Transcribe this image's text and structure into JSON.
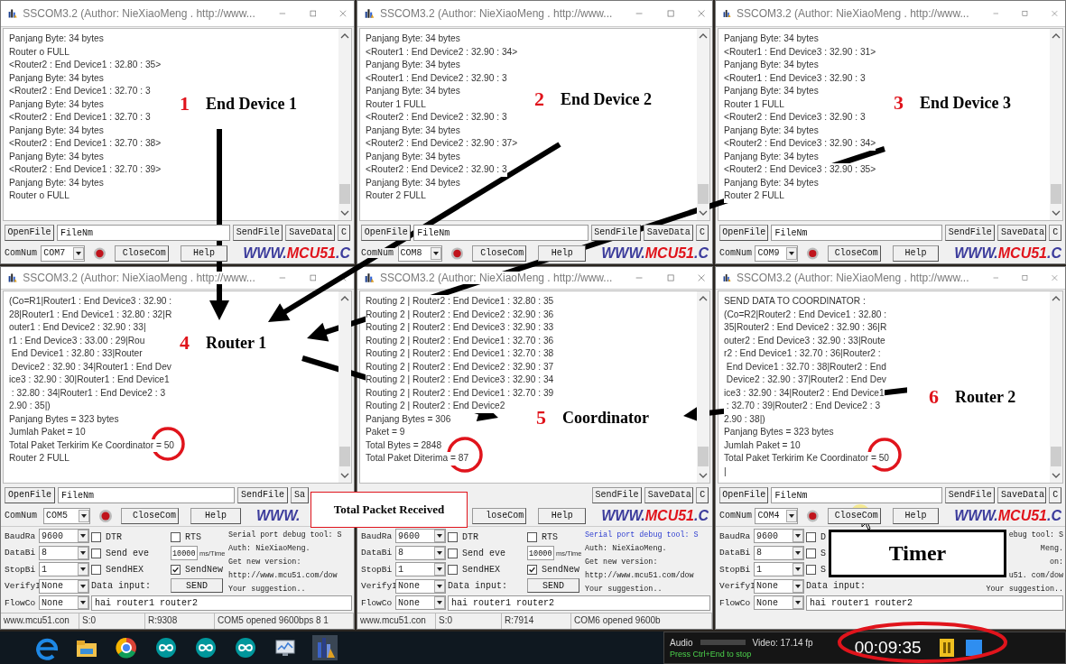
{
  "windows": [
    {
      "title": "SSCOM3.2 (Author: NieXiaoMeng . http://www...",
      "log": [
        "Panjang Byte: 34 bytes",
        "Router o FULL",
        "<Router2 : End Device1 : 32.80 : 35>",
        "Panjang Byte: 34 bytes",
        "<Router2 : End Device1 : 32.70 : 3",
        "Panjang Byte: 34 bytes",
        "<Router2 : End Device1 : 32.70 : 3",
        "Panjang Byte: 34 bytes",
        "<Router2 : End Device1 : 32.70 : 38>",
        "Panjang Byte: 34 bytes",
        "<Router2 : End Device1 : 32.70 : 39>",
        "Panjang Byte: 34 bytes",
        "Router o FULL"
      ],
      "file_row": {
        "open_button": "OpenFile",
        "file_field": "FileNm",
        "send_file": "SendFile",
        "save_data": "SaveData",
        "cut_button": "C"
      },
      "com_row": {
        "com_label": "ComNum",
        "com_port": "COM7",
        "close_button": "CloseCom",
        "help_button": "Help",
        "logo": {
          "prefix": "WWW.",
          "brand": "MCU51",
          "suffix": ".C"
        }
      }
    },
    {
      "title": "SSCOM3.2 (Author: NieXiaoMeng . http://www...",
      "log": [
        "Panjang Byte: 34 bytes",
        "<Router1 : End Device2 : 32.90 : 34>",
        "Panjang Byte: 34 bytes",
        "<Router1 : End Device2 : 32.90 : 3",
        "Panjang Byte: 34 bytes",
        "Router 1 FULL",
        "<Router2 : End Device2 : 32.90 : 3",
        "Panjang Byte: 34 bytes",
        "<Router2 : End Device2 : 32.90 : 37>",
        "Panjang Byte: 34 bytes",
        "<Router2 : End Device2 : 32.90 : 3",
        "Panjang Byte: 34 bytes",
        "Router 2 FULL"
      ],
      "file_row": {
        "open_button": "OpenFile",
        "file_field": "FileNm",
        "send_file": "SendFile",
        "save_data": "SaveData",
        "cut_button": "C"
      },
      "com_row": {
        "com_label": "ComNum",
        "com_port": "COM8",
        "close_button": "CloseCom",
        "help_button": "Help",
        "logo": {
          "prefix": "WWW.",
          "brand": "MCU51",
          "suffix": ".C"
        }
      }
    },
    {
      "title": "SSCOM3.2 (Author: NieXiaoMeng . http://www...",
      "log": [
        "Panjang Byte: 34 bytes",
        "<Router1 : End Device3 : 32.90 : 31>",
        "Panjang Byte: 34 bytes",
        "<Router1 : End Device3 : 32.90 : 3",
        "Panjang Byte: 34 bytes",
        "Router 1 FULL",
        "<Router2 : End Device3 : 32.90 : 3",
        "Panjang Byte: 34 bytes",
        "<Router2 : End Device3 : 32.90 : 34>",
        "Panjang Byte: 34 bytes",
        "<Router2 : End Device3 : 32.90 : 35>",
        "Panjang Byte: 34 bytes",
        "Router 2 FULL"
      ],
      "file_row": {
        "open_button": "OpenFile",
        "file_field": "FileNm",
        "send_file": "SendFile",
        "save_data": "SaveData",
        "cut_button": "C"
      },
      "com_row": {
        "com_label": "ComNum",
        "com_port": "COM9",
        "close_button": "CloseCom",
        "help_button": "Help",
        "logo": {
          "prefix": "WWW.",
          "brand": "MCU51",
          "suffix": ".C"
        }
      }
    },
    {
      "title": "SSCOM3.2 (Author: NieXiaoMeng . http://www...",
      "log": [
        "(Co=R1|Router1 : End Device3 : 32.90 :",
        "28|Router1 : End Device1 : 32.80 : 32|R",
        "outer1 : End Device2 : 32.90 : 33|",
        "r1 : End Device3 : 33.00 : 29|Rou",
        " End Device1 : 32.80 : 33|Router",
        " Device2 : 32.90 : 34|Router1 : End Dev",
        "ice3 : 32.90 : 30|Router1 : End Device1",
        " : 32.80 : 34|Router1 : End Device2 : 3",
        "2.90 : 35|)",
        "Panjang Bytes = 323 bytes",
        "Jumlah Paket = 10",
        "Total Paket Terkirim Ke Coordinator = 50",
        "Router 2 FULL"
      ],
      "file_row": {
        "open_button": "OpenFile",
        "file_field": "FileNm",
        "send_file": "SendFile",
        "save_data": "Sa"
      },
      "com_row": {
        "com_label": "ComNum",
        "com_port": "COM5",
        "close_button": "CloseCom",
        "help_button": "Help",
        "logo": {
          "prefix": "WWW."
        }
      },
      "panel": {
        "settings": [
          {
            "label": "BaudRa",
            "value": "9600"
          },
          {
            "label": "DataBi",
            "value": "8"
          },
          {
            "label": "StopBi",
            "value": "1"
          },
          {
            "label": "VerifyI",
            "value": "None"
          },
          {
            "label": "FlowCo",
            "value": "None"
          }
        ],
        "checkboxes": [
          {
            "label": "DTR",
            "checked": false
          },
          {
            "label": "Send eve",
            "checked": false
          },
          {
            "label": "SendHEX",
            "checked": false
          }
        ],
        "checkboxes_2": [
          {
            "label": "RTS",
            "checked": false
          },
          {
            "label": "SendNew",
            "checked": true
          }
        ],
        "interval": "10000",
        "interval_unit": "ms/Time",
        "data_input_label": "Data input:",
        "send_button": "SEND",
        "info": [
          {
            "text": "Serial port debug tool: S",
            "highlighted": false
          },
          {
            "text": "Auth: NieXiaoMeng.",
            "highlighted": false
          },
          {
            "text": "Get new version:",
            "highlighted": false
          },
          {
            "text": "http://www.mcu51.com/dow",
            "highlighted": false
          },
          {
            "text": "Your suggestion..",
            "highlighted": false
          }
        ],
        "data_input": "hai router1 router2"
      },
      "status_bar": [
        "www.mcu51.con",
        "S:0",
        "R:9308",
        "COM5 opened 9600bps 8 1"
      ]
    },
    {
      "title": "SSCOM3.2 (Author: NieXiaoMeng . http://www...",
      "log": [
        "Routing 2 | Router2 : End Device1 : 32.80 : 35",
        "Routing 2 | Router2 : End Device2 : 32.90 : 36",
        "Routing 2 | Router2 : End Device3 : 32.90 : 33",
        "Routing 2 | Router2 : End Device1 : 32.70 : 36",
        "Routing 2 | Router2 : End Device1 : 32.70 : 38",
        "Routing 2 | Router2 : End Device2 : 32.90 : 37",
        "Routing 2 | Router2 : End Device3 : 32.90 : 34",
        "Routing 2 | Router2 : End Device1 : 32.70 : 39",
        "Routing 2 | Router2 : End Device2",
        "Panjang Bytes = 306",
        "Paket = 9",
        "Total Bytes = 2848",
        "Total Paket Diterima = 87"
      ],
      "file_row": {
        "send_file": "SendFile",
        "save_data": "SaveData",
        "cut_button": "C"
      },
      "com_row": {
        "close_button": "loseCom",
        "help_button": "Help",
        "logo": {
          "prefix": "WWW.",
          "brand": "MCU51",
          "suffix": ".C"
        }
      },
      "panel": {
        "settings": [
          {
            "label": "BaudRa",
            "value": "9600"
          },
          {
            "label": "DataBi",
            "value": "8"
          },
          {
            "label": "StopBi",
            "value": "1"
          },
          {
            "label": "VerifyI",
            "value": "None"
          },
          {
            "label": "FlowCo",
            "value": "None"
          }
        ],
        "checkboxes": [
          {
            "label": "DTR",
            "checked": false
          },
          {
            "label": "Send eve",
            "checked": false
          },
          {
            "label": "SendHEX",
            "checked": false
          }
        ],
        "checkboxes_2": [
          {
            "label": "RTS",
            "checked": false
          },
          {
            "label": "SendNew",
            "checked": true
          }
        ],
        "interval": "10000",
        "interval_unit": "ms/Time",
        "data_input_label": "Data input:",
        "send_button": "SEND",
        "info": [
          {
            "text": "Serial port debug tool: S",
            "highlighted": true
          },
          {
            "text": "Auth: NieXiaoMeng.",
            "highlighted": false
          },
          {
            "text": "Get new version:",
            "highlighted": false
          },
          {
            "text": "http://www.mcu51.com/dow",
            "highlighted": false
          },
          {
            "text": "Your suggestion..",
            "highlighted": false
          }
        ],
        "data_input": "hai router1 router2"
      },
      "status_bar": [
        "www.mcu51.con",
        "S:0",
        "R:7914",
        "COM6 opened 9600b"
      ]
    },
    {
      "title": "SSCOM3.2 (Author: NieXiaoMeng . http://www...",
      "log": [
        "SEND DATA TO COORDINATOR :",
        "(Co=R2|Router2 : End Device1 : 32.80 :",
        "35|Router2 : End Device2 : 32.90 : 36|R",
        "outer2 : End Device3 : 32.90 : 33|Route",
        "r2 : End Device1 : 32.70 : 36|Router2 :",
        " End Device1 : 32.70 : 38|Router2 : End",
        " Device2 : 32.90 : 37|Router2 : End Dev",
        "ice3 : 32.90 : 34|Router2 : End Device1",
        " : 32.70 : 39|Router2 : End Device2 : 3",
        "2.90 : 38|)",
        "Panjang Bytes = 323 bytes",
        "Jumlah Paket = 10",
        "Total Paket Terkirim Ke Coordinator = 50",
        "|"
      ],
      "file_row": {
        "open_button": "OpenFile",
        "file_field": "FileNm",
        "send_file": "SendFile",
        "save_data": "SaveData",
        "cut_button": "C"
      },
      "com_row": {
        "com_label": "ComNum",
        "com_port": "COM4",
        "close_button": "CloseCom",
        "help_button": "Help",
        "logo": {
          "prefix": "WWW.",
          "brand": "MCU51",
          "suffix": ".C"
        }
      },
      "panel": {
        "settings": [
          {
            "label": "BaudRa",
            "value": "9600"
          },
          {
            "label": "DataBi",
            "value": "8"
          },
          {
            "label": "StopBi",
            "value": "1"
          },
          {
            "label": "VerifyI",
            "value": "None"
          },
          {
            "label": "FlowCo",
            "value": "None"
          }
        ],
        "checkboxes": [
          {
            "label": "D",
            "checked": false
          },
          {
            "label": "S",
            "checked": false
          },
          {
            "label": "S",
            "checked": false
          }
        ],
        "data_input_label": "Data input:",
        "info": [
          {
            "text": "ebug tool: S",
            "highlighted": false
          },
          {
            "text": "Meng.",
            "highlighted": false
          },
          {
            "text": "on:",
            "highlighted": false
          },
          {
            "text": "u51. com/dow",
            "highlighted": false
          },
          {
            "text": "Your suggestion..",
            "highlighted": false
          }
        ],
        "data_input": "hai router1 router2"
      }
    }
  ],
  "callouts": [
    {
      "number": "1",
      "text": "End Device 1"
    },
    {
      "number": "2",
      "text": "End Device 2"
    },
    {
      "number": "3",
      "text": "End Device 3"
    },
    {
      "number": "4",
      "text": "Router 1"
    },
    {
      "number": "5",
      "text": "Coordinator"
    },
    {
      "number": "6",
      "text": "Router 2"
    }
  ],
  "total_packet_label": "Total Packet Received",
  "timer_label": "Timer",
  "recorder": {
    "audio": "Audio",
    "hint": "Press Ctrl+End to stop",
    "video": "Video: 17.14 fp",
    "time": "00:09:35"
  }
}
